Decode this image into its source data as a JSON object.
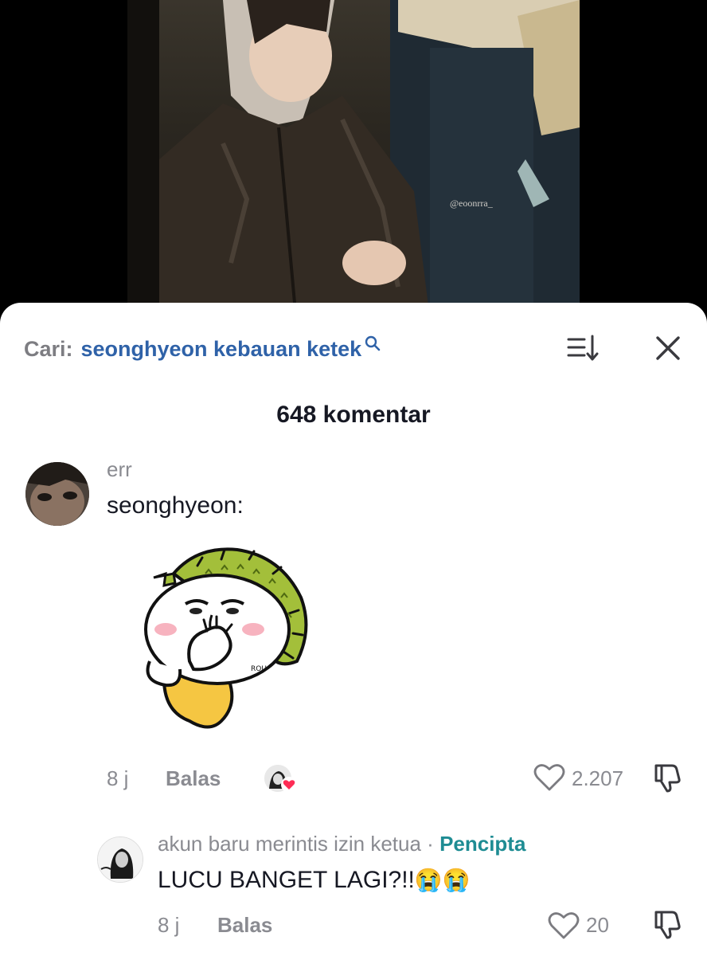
{
  "video": {
    "watermark": "@eoonrra_"
  },
  "search": {
    "prefix": "Cari:",
    "query": "seonghyeon kebauan ketek"
  },
  "comments_header": {
    "count_text": "648 komentar"
  },
  "comments": [
    {
      "username": "err",
      "text": "seonghyeon:",
      "sticker_label": "ROU",
      "time": "8 j",
      "reply_label": "Balas",
      "likes": "2.207"
    }
  ],
  "replies": [
    {
      "username": "akun baru merintis izin ketua",
      "separator": " · ",
      "creator_tag": "Pencipta",
      "text": "LUCU BANGET LAGI?!!",
      "emojis": "😭😭",
      "time": "8 j",
      "reply_label": "Balas",
      "likes": "20"
    }
  ],
  "colors": {
    "link_blue": "#2f62a8",
    "creator_teal": "#1e8c93",
    "muted_gray": "#8a8b91",
    "like_heart": "#fe2c55"
  }
}
